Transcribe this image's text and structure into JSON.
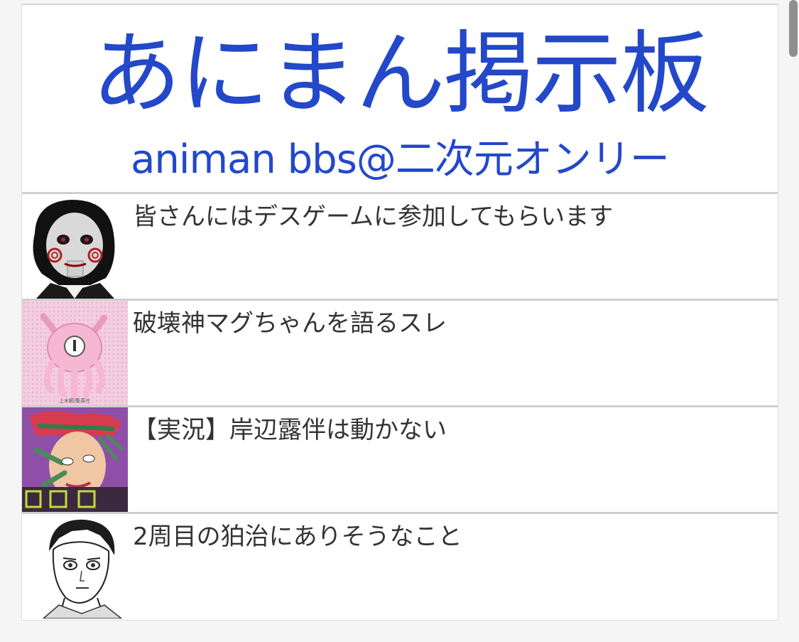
{
  "site": {
    "title": "あにまん掲示板",
    "subtitle": "animan bbs@二次元オンリー",
    "accent_color": "#2348c9"
  },
  "threads": [
    {
      "title": "皆さんにはデスゲームに参加してもらいます",
      "thumbnail": "puppet-mask-thumbnail"
    },
    {
      "title": "破壊神マグちゃんを語るスレ",
      "thumbnail": "pink-octopus-thumbnail"
    },
    {
      "title": "【実況】岸辺露伴は動かない",
      "thumbnail": "manga-cover-thumbnail"
    },
    {
      "title": "2周目の狛治にありそうなこと",
      "thumbnail": "manga-character-thumbnail"
    }
  ],
  "thumbnail_caption": "上木鋼/集英社"
}
